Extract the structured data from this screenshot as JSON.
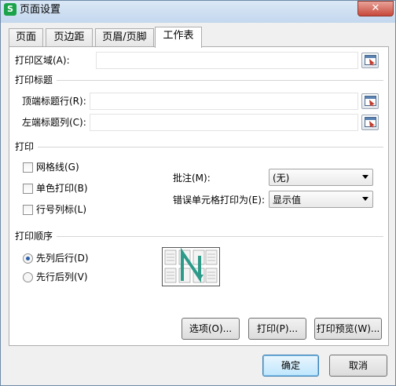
{
  "window": {
    "title": "页面设置",
    "app_icon_letter": "S",
    "close_symbol": "✕"
  },
  "tabs": [
    {
      "label": "页面"
    },
    {
      "label": "页边距"
    },
    {
      "label": "页眉/页脚"
    },
    {
      "label": "工作表"
    }
  ],
  "active_tab": "工作表",
  "print_area": {
    "label": "打印区域(A):",
    "value": ""
  },
  "print_titles": {
    "heading": "打印标题",
    "top_rows": {
      "label": "顶端标题行(R):",
      "value": ""
    },
    "left_cols": {
      "label": "左端标题列(C):",
      "value": ""
    }
  },
  "print": {
    "heading": "打印",
    "checkboxes": [
      {
        "label": "网格线(G)",
        "checked": false
      },
      {
        "label": "单色打印(B)",
        "checked": false
      },
      {
        "label": "行号列标(L)",
        "checked": false
      }
    ],
    "comments": {
      "label": "批注(M):",
      "value": "(无)"
    },
    "cell_errors": {
      "label": "错误单元格打印为(E):",
      "value": "显示值"
    }
  },
  "page_order": {
    "heading": "打印顺序",
    "options": [
      {
        "label": "先列后行(D)",
        "selected": true
      },
      {
        "label": "先行后列(V)",
        "selected": false
      }
    ]
  },
  "panel_buttons": {
    "options": "选项(O)...",
    "print": "打印(P)...",
    "preview": "打印预览(W)..."
  },
  "dialog_buttons": {
    "ok": "确定",
    "cancel": "取消"
  },
  "colors": {
    "title_bar": "#c3d7ee",
    "close_button": "#c7483a",
    "arrow": "#2e9b8a"
  }
}
